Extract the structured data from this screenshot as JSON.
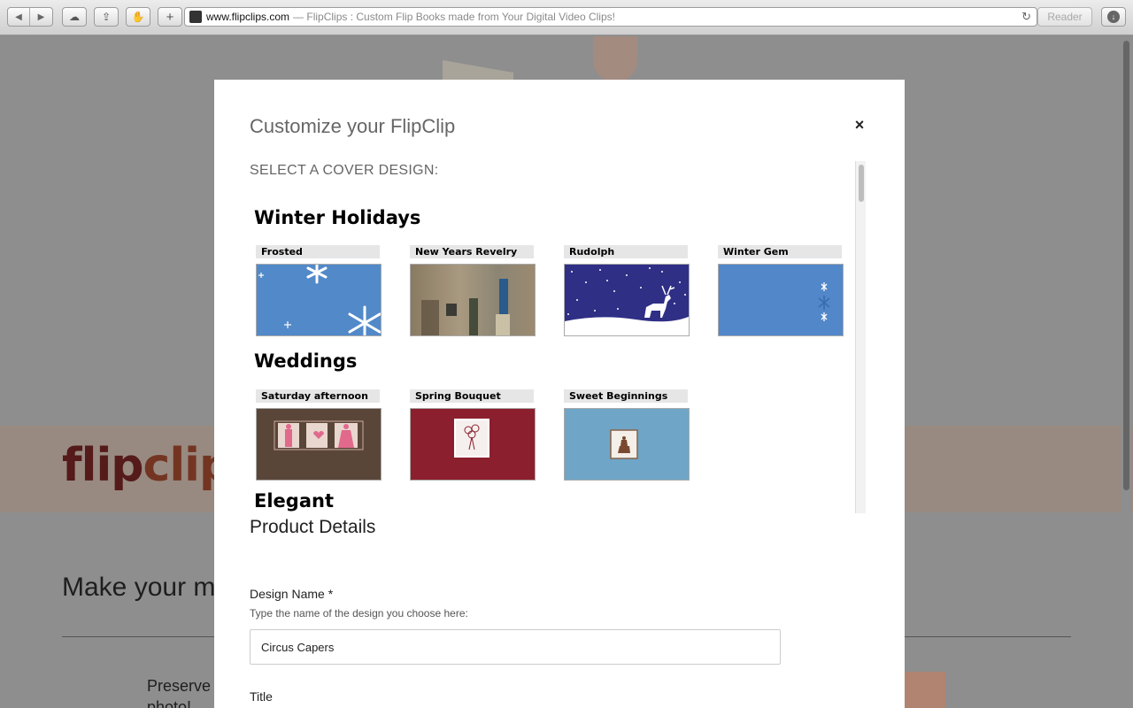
{
  "browser": {
    "url": "www.flipclips.com",
    "page_title": "— FlipClips : Custom Flip Books made from Your Digital Video Clips!",
    "reader_label": "Reader"
  },
  "background": {
    "logo_part1": "flip",
    "logo_part2": "clips",
    "heading": "Make your m",
    "paragraph_line1": "Preserve",
    "paragraph_line2": "photo!"
  },
  "modal": {
    "title": "Customize your FlipClip",
    "close_label": "×",
    "cover_prompt": "SELECT A COVER DESIGN:",
    "categories": [
      {
        "name": "Winter Holidays",
        "designs": [
          "Frosted",
          "New Years Revelry",
          "Rudolph",
          "Winter Gem"
        ]
      },
      {
        "name": "Weddings",
        "designs": [
          "Saturday afternoon",
          "Spring Bouquet",
          "Sweet Beginnings"
        ]
      },
      {
        "name": "Elegant",
        "designs": []
      }
    ],
    "product_details": {
      "heading": "Product Details",
      "design_name_label": "Design Name *",
      "design_name_help": "Type the name of the design you choose here:",
      "design_name_value": "Circus Capers",
      "title_label": "Title"
    }
  },
  "colors": {
    "frosted_bg": "#5289c9",
    "rudolph_bg": "#2f2f86",
    "winter_gem_bg": "#5287c9",
    "saturday_bg": "#5a4638",
    "spring_bouquet_bg": "#8c1f2d",
    "sweet_beginnings_bg": "#6fa5c6"
  }
}
